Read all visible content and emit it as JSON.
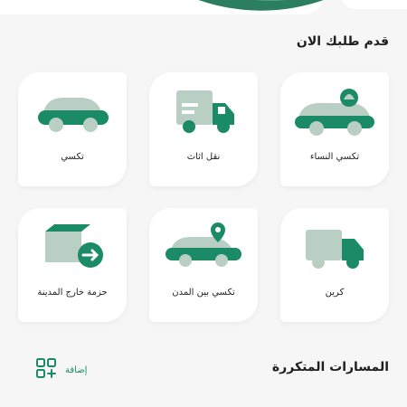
{
  "order_section": {
    "title": "قدم طلبك الان"
  },
  "services": [
    {
      "label": "تكسي النساء",
      "icon": "women-taxi-icon"
    },
    {
      "label": "نقل اثاث",
      "icon": "moving-truck-icon"
    },
    {
      "label": "تكسي",
      "icon": "taxi-car-icon"
    },
    {
      "label": "كرين",
      "icon": "crane-truck-icon"
    },
    {
      "label": "تكسي بين المدن",
      "icon": "intercity-taxi-icon"
    },
    {
      "label": "حزمة خارج المدينة",
      "icon": "package-outside-city-icon"
    }
  ],
  "routes_section": {
    "title": "المسارات المتكررة",
    "add_label": "إضافة"
  },
  "colors": {
    "accent": "#1b8a67",
    "accent_light": "#b9cfc3",
    "bg": "#f6f6f6",
    "card": "#ffffff"
  }
}
